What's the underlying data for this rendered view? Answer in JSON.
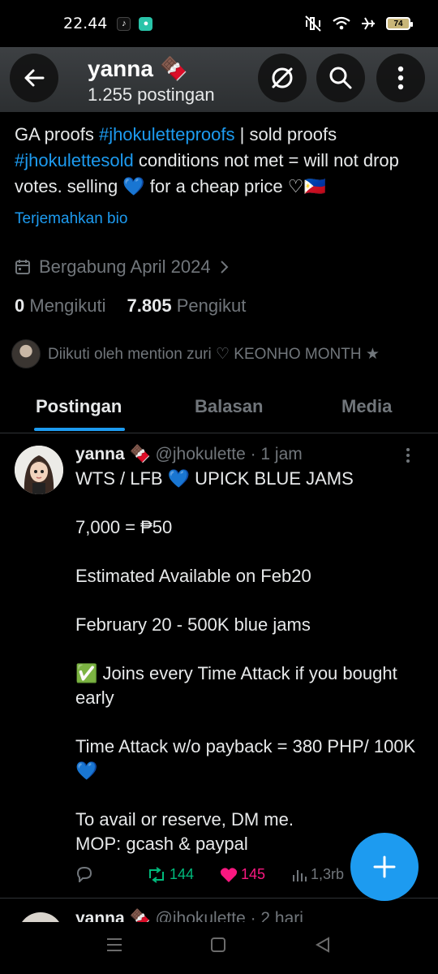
{
  "status_bar": {
    "time": "22.44",
    "battery": "74"
  },
  "header": {
    "name": "yanna 🍫",
    "post_count": "1.255 postingan"
  },
  "bio": {
    "t1": "GA proofs ",
    "tag1": "#jhokuletteproofs",
    "t2": " | sold proofs ",
    "tag2": "#jhokulettesold",
    "t3": " conditions not met = will not drop votes. selling 💙 for a cheap price ♡🇵🇭",
    "translate": "Terjemahkan bio"
  },
  "joined": "Bergabung April 2024",
  "following": {
    "count": "0",
    "label": "Mengikuti"
  },
  "followers": {
    "count": "7.805",
    "label": "Pengikut"
  },
  "followed_by": "Diikuti oleh mention zuri ♡ KEONHO MONTH ★",
  "tabs": {
    "posts": "Postingan",
    "replies": "Balasan",
    "media": "Media"
  },
  "post": {
    "author": "yanna 🍫",
    "handle": "@jhokulette",
    "time": "· 1 jam",
    "lines": [
      "WTS / LFB 💙 UPICK BLUE JAMS",
      "7,000 = ₱50",
      "Estimated Available on Feb20",
      "February 20 - 500K blue jams",
      "✅ Joins every Time Attack if you bought early",
      "Time Attack w/o payback = 380 PHP/ 100K 💙",
      "To avail or reserve, DM me.",
      "MOP: gcash & paypal"
    ],
    "reposts": "144",
    "likes": "145",
    "views": "1,3rb"
  },
  "next_post": {
    "author": "yanna 🍫",
    "handle": "@jhokulette",
    "time": "· 2 hari"
  },
  "colors": {
    "accent": "#1d9bf0",
    "repost": "#00ba7c",
    "like": "#f91880",
    "muted": "#71767b"
  }
}
